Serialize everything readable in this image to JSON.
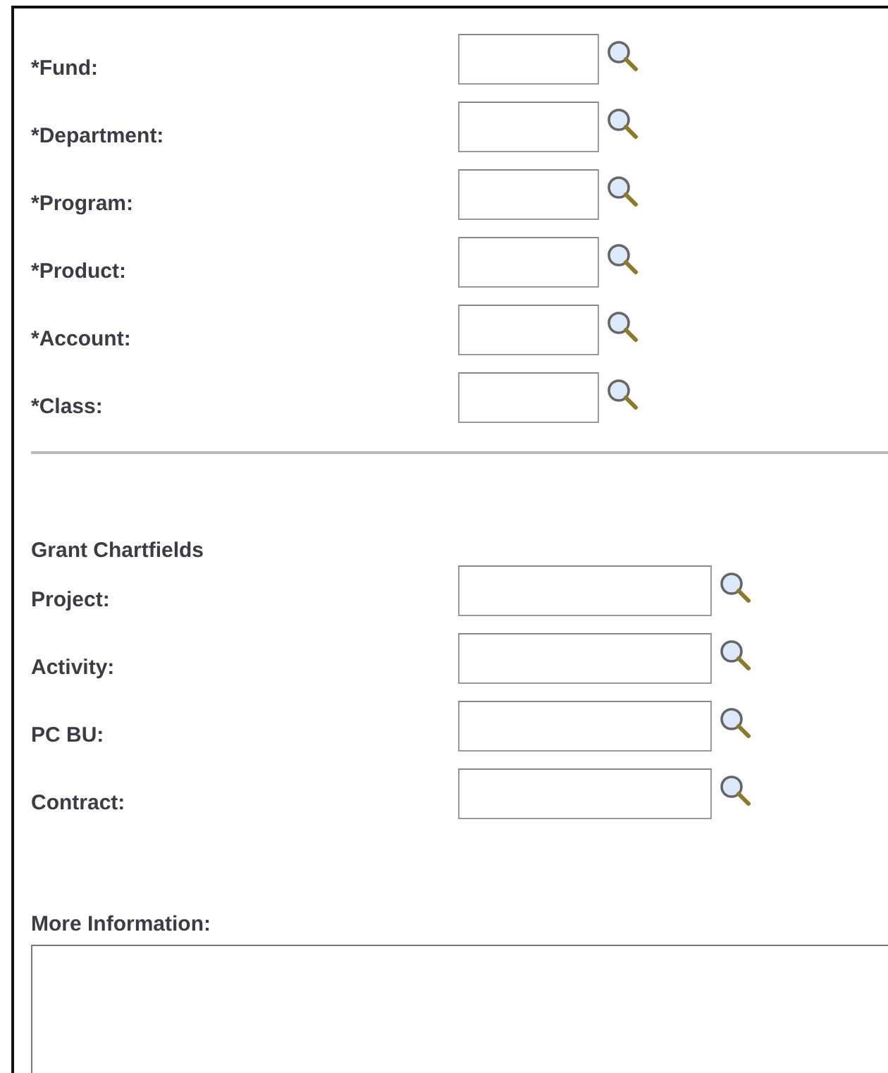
{
  "chartfields": [
    {
      "label": "*Fund:"
    },
    {
      "label": "*Department:"
    },
    {
      "label": "*Program:"
    },
    {
      "label": "*Product:"
    },
    {
      "label": "*Account:"
    },
    {
      "label": "*Class:"
    }
  ],
  "grant": {
    "heading": "Grant Chartfields",
    "fields": [
      {
        "label": "Project:"
      },
      {
        "label": "Activity:"
      },
      {
        "label": "PC BU:"
      },
      {
        "label": "Contract:"
      }
    ]
  },
  "more_information": {
    "label": "More Information:"
  }
}
